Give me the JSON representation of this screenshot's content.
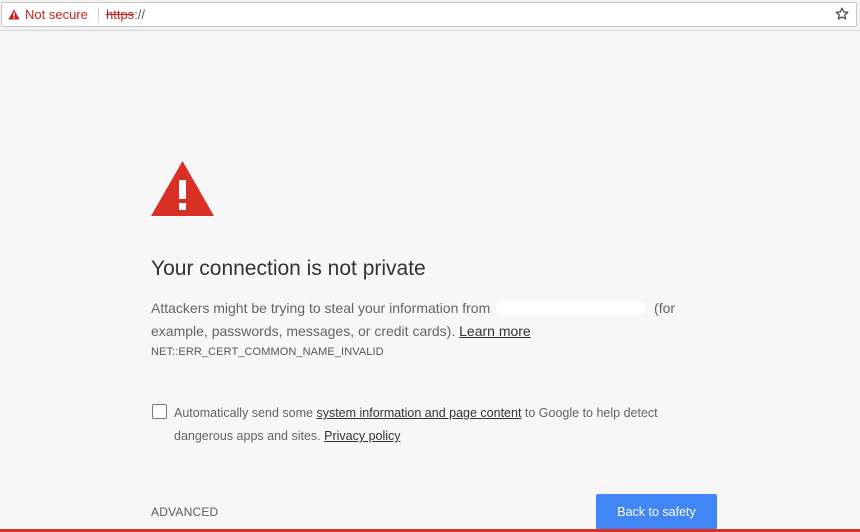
{
  "omnibox": {
    "security_label": "Not secure",
    "url_scheme": "https",
    "url_rest": "://",
    "security_icon": "warning-triangle-icon",
    "bookmark_icon": "star-outline-icon"
  },
  "interstitial": {
    "icon": "warning-triangle-icon",
    "heading": "Your connection is not private",
    "message_prefix": "Attackers might be trying to steal your information from",
    "message_suffix": "(for example, passwords, messages, or credit cards).",
    "learn_more": "Learn more",
    "error_code": "NET::ERR_CERT_COMMON_NAME_INVALID",
    "reporting": {
      "text_prefix": "Automatically send some",
      "link_system_info": "system information and page content",
      "text_middle": "to Google to help detect dangerous apps and sites.",
      "link_privacy": "Privacy policy",
      "checked": false
    },
    "advanced_label": "ADVANCED",
    "back_to_safety_label": "Back to safety"
  },
  "colors": {
    "danger_red": "#d93025",
    "primary_blue": "#4285f4",
    "page_background": "#f7f7f7"
  }
}
